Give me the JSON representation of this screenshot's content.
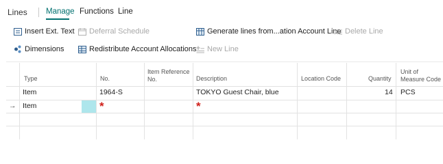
{
  "tabs": {
    "title": "Lines",
    "manage": "Manage",
    "functions": "Functions",
    "line": "Line"
  },
  "actions": {
    "insert_ext_text": "Insert Ext. Text",
    "deferral_schedule": "Deferral Schedule",
    "generate_lines": "Generate lines from...ation Account Line",
    "delete_line": "Delete Line",
    "dimensions": "Dimensions",
    "redistribute": "Redistribute Account Allocations",
    "new_line": "New Line"
  },
  "columns": {
    "type": "Type",
    "no": "No.",
    "item_ref_1": "Item Reference",
    "item_ref_2": "No.",
    "description": "Description",
    "location": "Location Code",
    "quantity": "Quantity",
    "uom_1": "Unit of",
    "uom_2": "Measure Code"
  },
  "rows": [
    {
      "type": "Item",
      "no": "1964-S",
      "item_ref": "",
      "description": "TOKYO Guest Chair, blue",
      "location": "",
      "quantity": "14",
      "uom": "PCS"
    },
    {
      "type": "Item",
      "no": "",
      "item_ref": "",
      "description": "",
      "location": "",
      "quantity": "",
      "uom": ""
    }
  ],
  "indicators": {
    "current_row": "→",
    "required": "*"
  },
  "colors": {
    "accent": "#00706f",
    "required": "#d0201a",
    "selected_cell": "#aee6ec"
  }
}
